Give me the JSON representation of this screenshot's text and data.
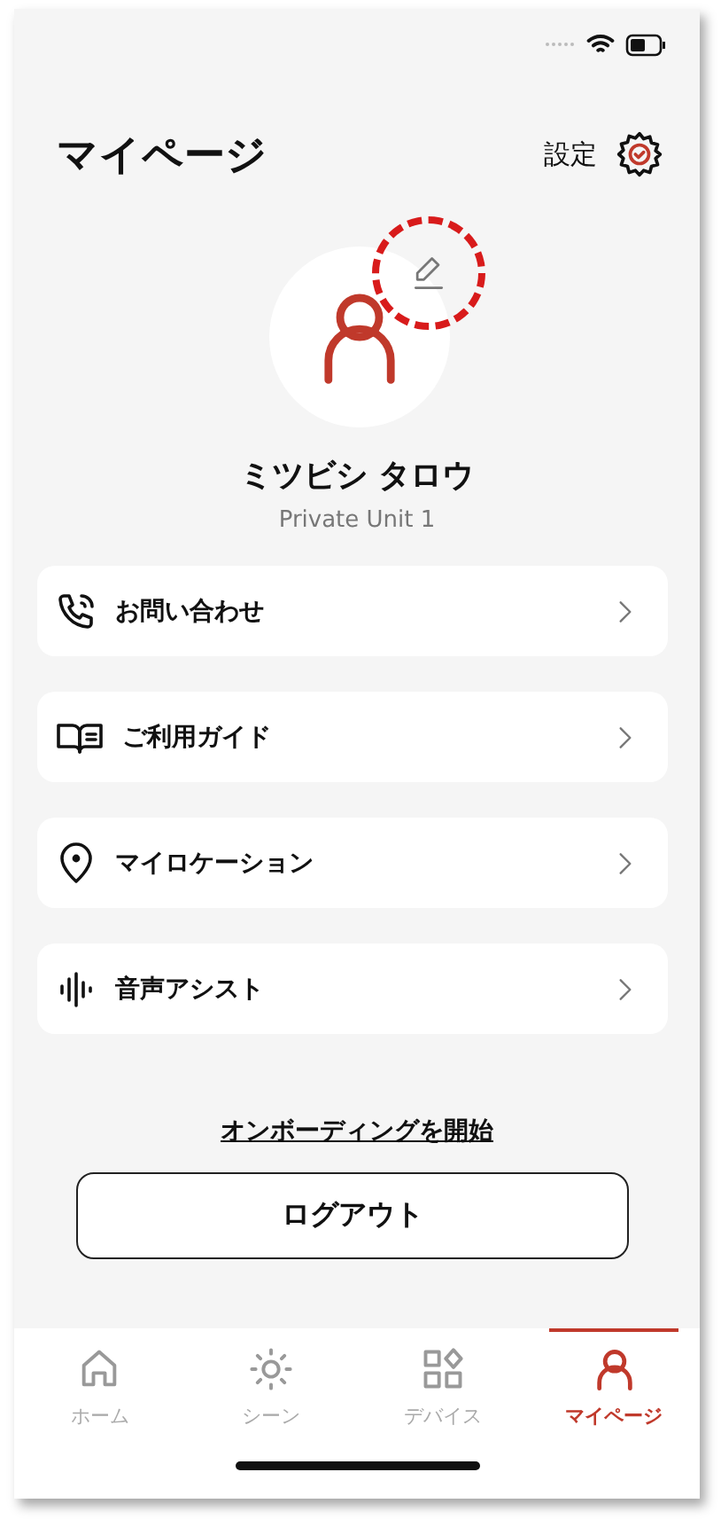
{
  "header": {
    "title": "マイページ",
    "settings_label": "設定"
  },
  "profile": {
    "name": "ミツビシ タロウ",
    "subtitle": "Private Unit 1",
    "edit_highlighted": true
  },
  "menu_items": [
    {
      "kind": "phone",
      "label": "お問い合わせ"
    },
    {
      "kind": "book",
      "label": "ご利用ガイド"
    },
    {
      "kind": "pin",
      "label": "マイロケーション"
    },
    {
      "kind": "voice",
      "label": "音声アシスト"
    }
  ],
  "onboarding_link": "オンボーディングを開始",
  "logout_button": "ログアウト",
  "tabs": [
    {
      "kind": "home",
      "label": "ホーム",
      "selected": false
    },
    {
      "kind": "scene",
      "label": "シーン",
      "selected": false
    },
    {
      "kind": "devices",
      "label": "デバイス",
      "selected": false
    },
    {
      "kind": "mypage",
      "label": "マイページ",
      "selected": true
    }
  ]
}
